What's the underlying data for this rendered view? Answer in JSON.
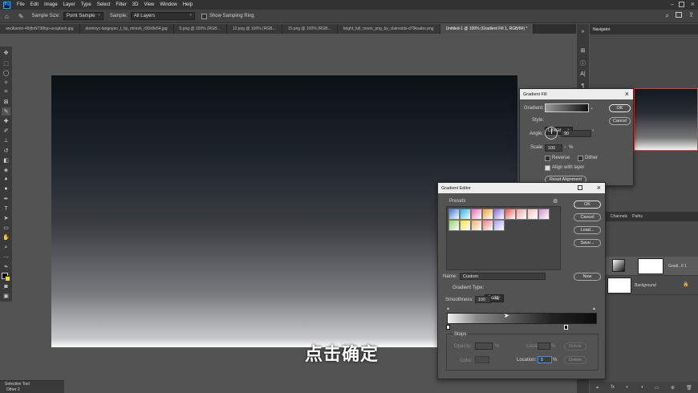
{
  "app": {
    "logo": "Ps"
  },
  "menu": [
    "File",
    "Edit",
    "Image",
    "Layer",
    "Type",
    "Select",
    "Filter",
    "3D",
    "View",
    "Window",
    "Help"
  ],
  "options": {
    "sample_size_label": "Sample Size:",
    "sample_size_value": "Point Sample",
    "sample_label": "Sample:",
    "sample_value": "All Layers",
    "show_ring_label": "Show Sampling Ring"
  },
  "tabs": [
    "ancillamin-48ijfoNT3l8qo-unsplash.jpg",
    "dominyc-langoyen_t_by_minish_r9l3r8e54.jpg",
    "5.png @ 100% (RGB...",
    "12.png @ 100% (RGB...",
    "15.png @ 100% (RGB...",
    "bright_full_moon_png_by_clairvoids-d79ksabo.png",
    "Untitled-1 @ 100% (Gradient Fill 1, RGB/8#) *"
  ],
  "panels": {
    "navigator": "Navigator",
    "channels": "Channels",
    "paths": "Paths",
    "layer_gradient": "Gradi...ll 1",
    "layer_background": "Background"
  },
  "gradient_fill": {
    "title": "Gradient Fill",
    "gradient_label": "Gradient:",
    "style_label": "Style:",
    "style_value": "Linear",
    "angle_label": "Angle:",
    "angle_value": "90",
    "angle_unit": "°",
    "scale_label": "Scale:",
    "scale_value": "100",
    "scale_unit": "%",
    "reverse_label": "Reverse",
    "dither_label": "Dither",
    "align_label": "Align with layer",
    "reset_label": "Reset Alignment",
    "ok": "OK",
    "cancel": "Cancel"
  },
  "gradient_editor": {
    "title": "Gradient Editor",
    "presets_label": "Presets",
    "ok": "OK",
    "cancel": "Cancel",
    "load": "Load...",
    "save": "Save...",
    "name_label": "Name:",
    "name_value": "Custom",
    "new_label": "New",
    "type_label": "Gradient Type:",
    "type_value": "Solid",
    "smooth_label": "Smoothness:",
    "smooth_value": "100",
    "smooth_unit": "%",
    "stops_label": "Stops",
    "opacity_label": "Opacity:",
    "opacity_unit": "%",
    "location_label": "Location:",
    "location_unit": "%",
    "delete_label": "Delete",
    "color_label": "Color:",
    "location2_label": "Location:",
    "location2_value": "5",
    "location2_unit": "%",
    "delete2_label": "Delete",
    "preset_colors": [
      "#3a78d8",
      "#2bb0e8",
      "#e86bb0",
      "#f2a03a",
      "#8a6bd8",
      "#e85050",
      "#f0a0a0",
      "#f5c0c0",
      "#d090d0",
      "#8fd06a",
      "#f0e040",
      "#f0b070",
      "#f08080",
      "#a0a0f0"
    ]
  },
  "subtitle": "点击确定",
  "bottom_panel": {
    "title": "Selective Tool",
    "item": "Other 2"
  }
}
